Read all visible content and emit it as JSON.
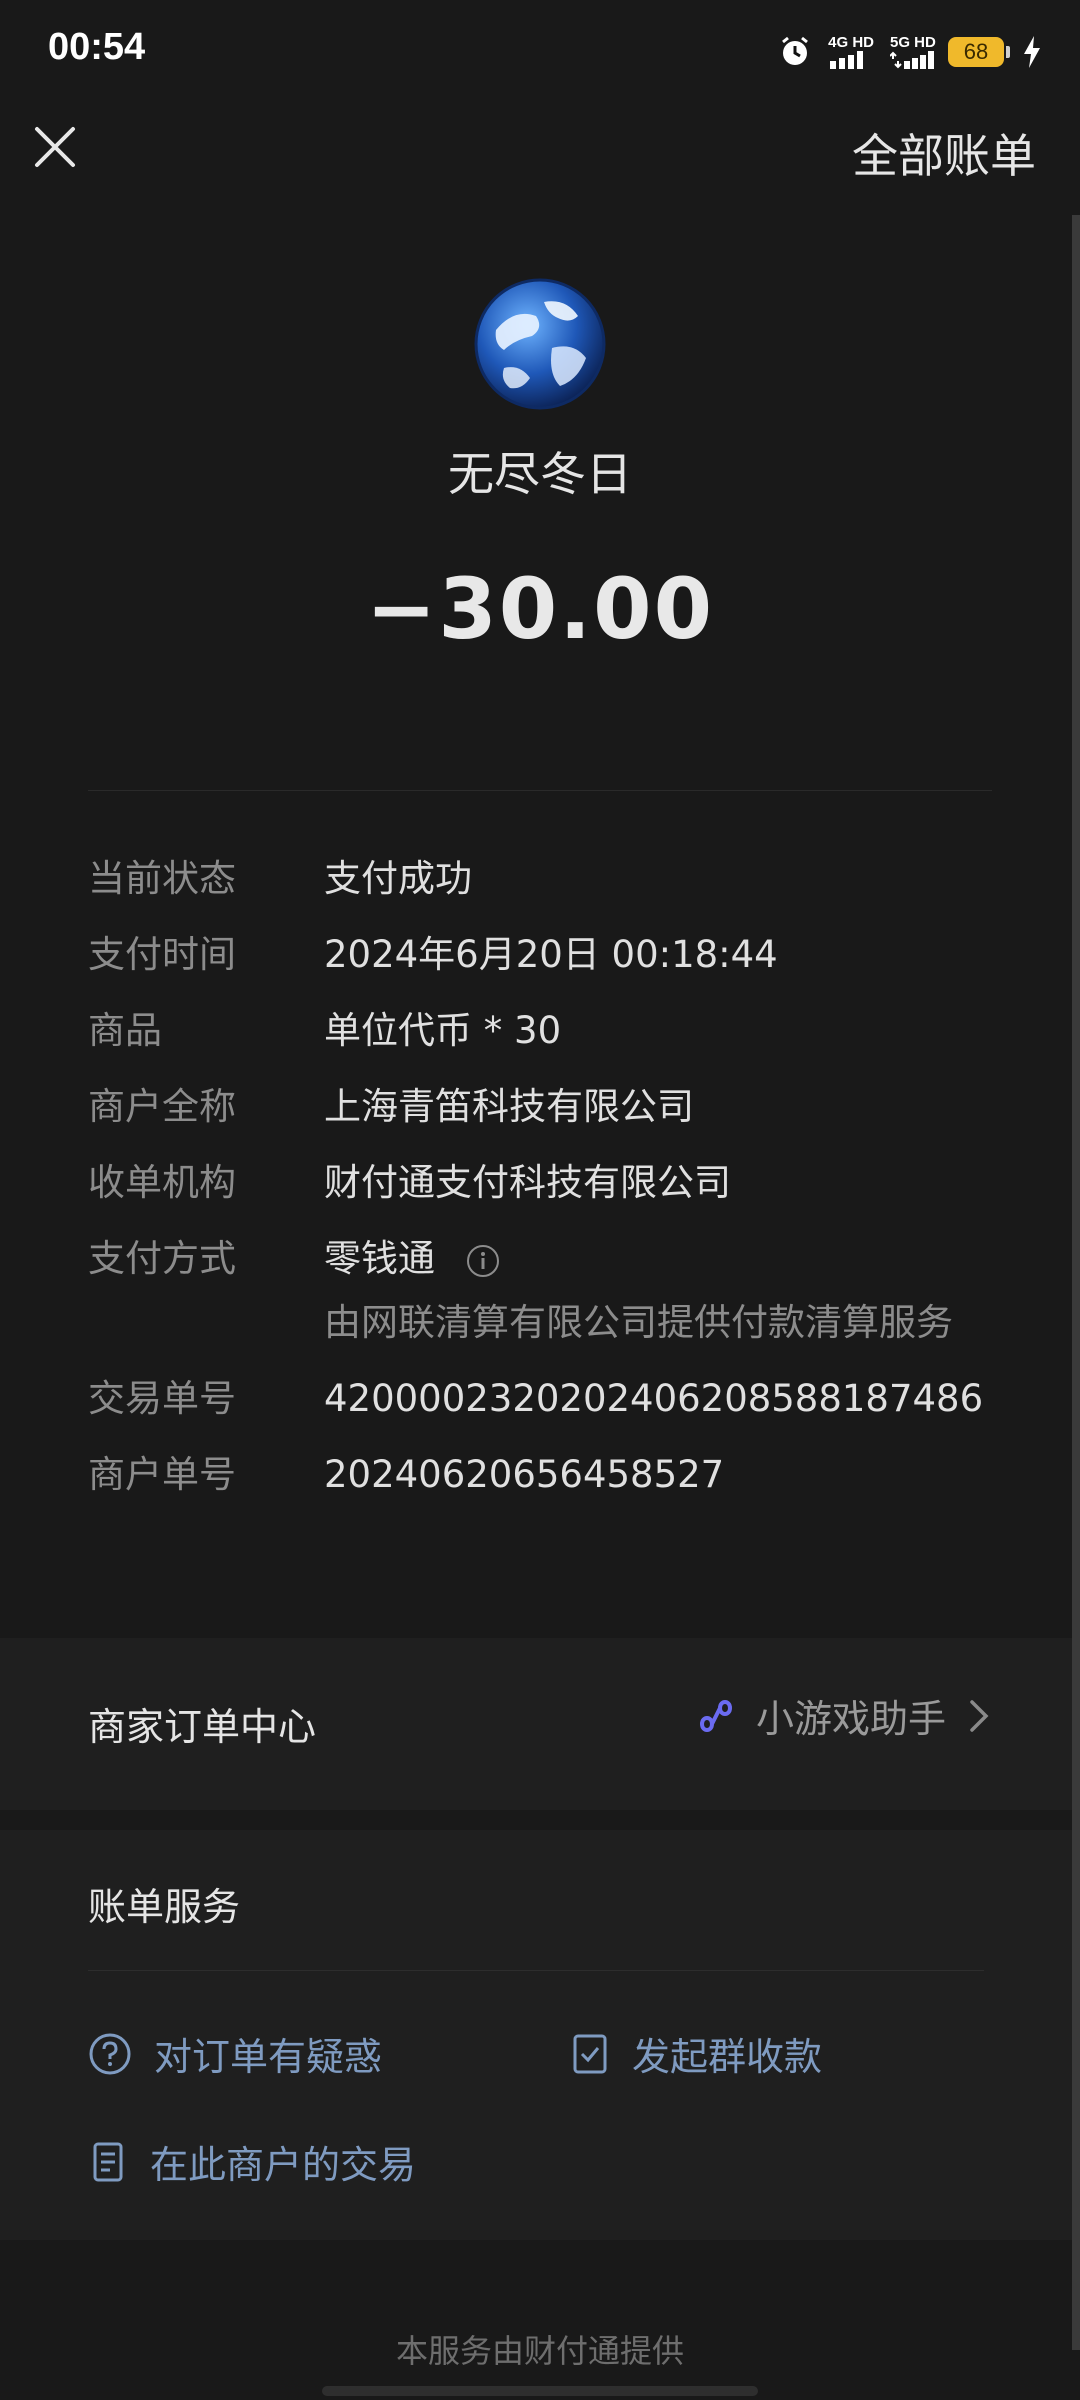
{
  "status_bar": {
    "time": "00:54",
    "network1": "4G HD",
    "network2": "5G HD",
    "battery": "68"
  },
  "header": {
    "close_icon": "close-icon",
    "all_bills": "全部账单"
  },
  "merchant": {
    "name": "无尽冬日",
    "amount": "−30.00"
  },
  "details": [
    {
      "label": "当前状态",
      "value": "支付成功"
    },
    {
      "label": "支付时间",
      "value": "2024年6月20日 00:18:44"
    },
    {
      "label": "商品",
      "value": "单位代币 * 30"
    },
    {
      "label": "商户全称",
      "value": "上海青笛科技有限公司"
    },
    {
      "label": "收单机构",
      "value": "财付通支付科技有限公司"
    },
    {
      "label": "支付方式",
      "value": "零钱通",
      "sub": "由网联清算有限公司提供付款清算服务"
    },
    {
      "label": "交易单号",
      "value": "4200002320202406208588187486"
    },
    {
      "label": "商户单号",
      "value": "20240620656458527"
    }
  ],
  "merchant_center": {
    "title": "商家订单中心",
    "link_label": "小游戏助手"
  },
  "bill_service": {
    "title": "账单服务",
    "items": [
      "对订单有疑惑",
      "发起群收款",
      "在此商户的交易"
    ]
  },
  "footer": "本服务由财付通提供",
  "colors": {
    "background": "#191919",
    "card": "#1f1f1f",
    "link_blue": "#7f9bc1",
    "battery": "#f0b92b"
  }
}
